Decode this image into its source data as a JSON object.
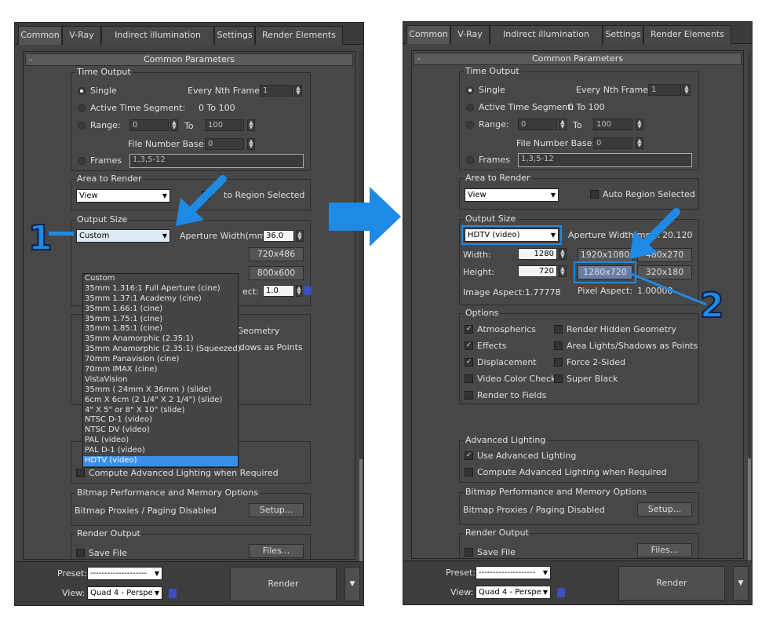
{
  "tabs": [
    "Common",
    "V-Ray",
    "Indirect illumination",
    "Settings",
    "Render Elements"
  ],
  "rollout_title": "Common Parameters",
  "rollout_minus": "-",
  "time_output": {
    "label": "Time Output",
    "single": "Single",
    "every_nth": "Every Nth Frame:",
    "every_nth_value": "1",
    "active_segment": "Active Time Segment:",
    "active_range": "0 To 100",
    "range": "Range:",
    "range_from": "0",
    "to": "To",
    "range_to": "100",
    "file_number_base": "File Number Base:",
    "file_number_value": "0",
    "frames": "Frames",
    "frames_value": "1,3,5-12"
  },
  "area_to_render": {
    "label": "Area to Render",
    "value": "View",
    "auto_region": "Auto Region Selected",
    "auto_region_partial": "to Region Selected"
  },
  "output_size": {
    "label": "Output Size",
    "left_value": "Custom",
    "right_value": "HDTV (video)",
    "aperture": "Aperture Width(mm):",
    "aperture_value": "36.0",
    "aperture_partial": "Aperture Width(mm):",
    "aperture_value_right": "20.120",
    "width_label": "Width:",
    "height_label": "Height:",
    "width_value": "1280",
    "height_value": "720",
    "presets_left": [
      "720x486",
      "800x600"
    ],
    "presets_right": [
      "1920x1080",
      "480x270",
      "1280x720",
      "320x180"
    ],
    "image_aspect": "Image Aspect:1.77778",
    "pixel_aspect": "Pixel Aspect:",
    "pixel_aspect_value": "1.00000",
    "pixel_aspect_left": "ect:",
    "pixel_aspect_left_value": "1.0"
  },
  "dropdown_items": [
    "Custom",
    "35mm 1.316:1 Full Aperture (cine)",
    "35mm 1.37:1 Academy (cine)",
    "35mm 1.66:1 (cine)",
    "35mm 1.75:1 (cine)",
    "35mm 1.85:1 (cine)",
    "35mm Anamorphic (2.35:1)",
    "35mm Anamorphic (2.35:1)  (Squeezed)",
    "70mm Panavision (cine)",
    "70mm IMAX (cine)",
    "VistaVision",
    "35mm ( 24mm X 36mm ) (slide)",
    "6cm X 6cm (2 1/4\" X 2 1/4\") (slide)",
    "4\" X 5\" or 8\" X 10\" (slide)",
    "NTSC D-1 (video)",
    "NTSC DV (video)",
    "PAL (video)",
    "PAL D-1 (video)",
    "HDTV (video)"
  ],
  "options": {
    "label": "Options",
    "atmospherics": "Atmospherics",
    "effects": "Effects",
    "displacement": "Displacement",
    "video_color_check": "Video Color Check",
    "render_to_fields": "Render to Fields",
    "render_hidden_geometry": "Render Hidden Geometry",
    "area_lights": "Area Lights/Shadows as Points",
    "force_2sided": "Force 2-Sided",
    "super_black": "Super Black",
    "partial_geometry": "n Geometry",
    "partial_shadows": "hadows as Points"
  },
  "advanced_lighting": {
    "label": "Advanced Lighting",
    "use": "Use Advanced Lighting",
    "compute": "Compute Advanced Lighting when Required"
  },
  "bitmap": {
    "label": "Bitmap Performance and Memory Options",
    "status": "Bitmap Proxies / Paging Disabled",
    "setup": "Setup..."
  },
  "render_output": {
    "label": "Render Output",
    "save_file": "Save File",
    "files": "Files..."
  },
  "bottom": {
    "preset_label": "Preset:",
    "preset_value": "--------------------",
    "view_label": "View:",
    "view_value": "Quad 4 - Perspe",
    "render": "Render"
  },
  "annotations": {
    "one": "1",
    "two": "2"
  },
  "colors": {
    "accent": "#1e8ae6",
    "panel": "#444444"
  }
}
